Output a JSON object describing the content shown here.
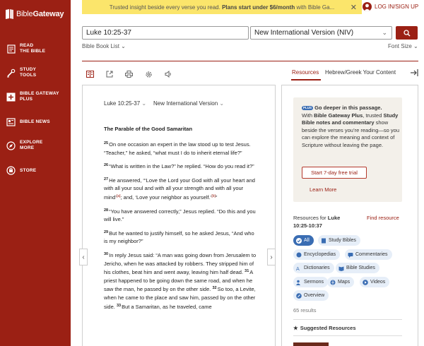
{
  "sidebar": {
    "logo": {
      "part1": "Bible",
      "part2": "Gateway"
    },
    "items": [
      {
        "label_line1": "READ",
        "label_line2": "THE BIBLE",
        "icon": "book-icon"
      },
      {
        "label_line1": "STUDY",
        "label_line2": "TOOLS",
        "icon": "study-tools-icon"
      },
      {
        "label_line1": "BIBLE GATEWAY",
        "label_line2": "PLUS",
        "icon": "plus-icon"
      },
      {
        "label_line1": "BIBLE NEWS",
        "label_line2": "",
        "icon": "news-icon"
      },
      {
        "label_line1": "EXPLORE",
        "label_line2": "MORE",
        "icon": "compass-icon"
      },
      {
        "label_line1": "STORE",
        "label_line2": "",
        "icon": "store-icon"
      }
    ]
  },
  "banner": {
    "text": "Trusted insight beside every verse you read. ",
    "bold": "Plans start under $6/month",
    "tail": " with Bible Ga..."
  },
  "login": {
    "label": "LOG IN/SIGN UP"
  },
  "search": {
    "reference": "Luke 10:25-37",
    "version": "New International Version (NIV)"
  },
  "subnav": {
    "book_list": "Bible Book List",
    "font_size": "Font Size"
  },
  "panel_tabs": {
    "resources": "Resources",
    "hebrew_greek": "Hebrew/Greek Your Content"
  },
  "passage": {
    "reference": "Luke 10:25-37",
    "version": "New International Version",
    "heading": "The Parable of the Good Samaritan",
    "verses": [
      {
        "num": "25",
        "text": "On one occasion an expert in the law stood up to test Jesus. “Teacher,” he asked, “what must I do to inherit eternal life?”"
      },
      {
        "num": "26",
        "text": "“What is written in the Law?” he replied. “How do you read it?”"
      },
      {
        "num": "27",
        "text": "He answered, “‘Love the Lord your God with all your heart and with all your soul and with all your strength and with all your mind’",
        "fn1": "[a]",
        "text2": "; and, ‘Love your neighbor as yourself.’",
        "fn2": "[b]",
        "text3": "”"
      },
      {
        "num": "28",
        "text": "“You have answered correctly,” Jesus replied. “Do this and you will live.”"
      },
      {
        "num": "29",
        "text": "But he wanted to justify himself, so he asked Jesus, “And who is my neighbor?”"
      },
      {
        "num": "30",
        "text": "In reply Jesus said: “A man was going down from Jerusalem to Jericho, when he was attacked by robbers. They stripped him of his clothes, beat him and went away, leaving him half dead. ",
        "num2": "31",
        "text2": "A priest happened to be going down the same road, and when he saw the man, he passed by on the other side. ",
        "num3": "32",
        "text3": "So too, a Levite, when he came to the place and saw him, passed by on the other side. ",
        "num4": "33",
        "text4": "But a Samaritan, as he traveled, came"
      }
    ]
  },
  "plus_promo": {
    "badge": "PLUS",
    "title": "Go deeper in this passage.",
    "t1": "With ",
    "b1": "Bible Gateway Plus",
    "t2": ", trusted ",
    "b2": "Study Bible notes and commentary",
    "t3": " show beside the verses you’re reading—so you can explore the meaning and context of Scripture without leaving the page.",
    "trial_button": "Start 7-day free trial",
    "learn_more": "Learn More"
  },
  "resources": {
    "for_prefix": "Resources for ",
    "for_ref": "Luke 10:25-10:37",
    "find": "Find resource",
    "filters": [
      "All",
      "Study Bibles",
      "Encyclopedias",
      "Commentaries",
      "Dictionaries",
      "Bible Studies",
      "Sermons",
      "Maps",
      "Videos",
      "Overview"
    ],
    "results": "65 results",
    "suggested": "Suggested Resources"
  },
  "colors": {
    "brand": "#9b2014",
    "banner": "#fbe56b",
    "filter_active": "#3a6db3"
  }
}
